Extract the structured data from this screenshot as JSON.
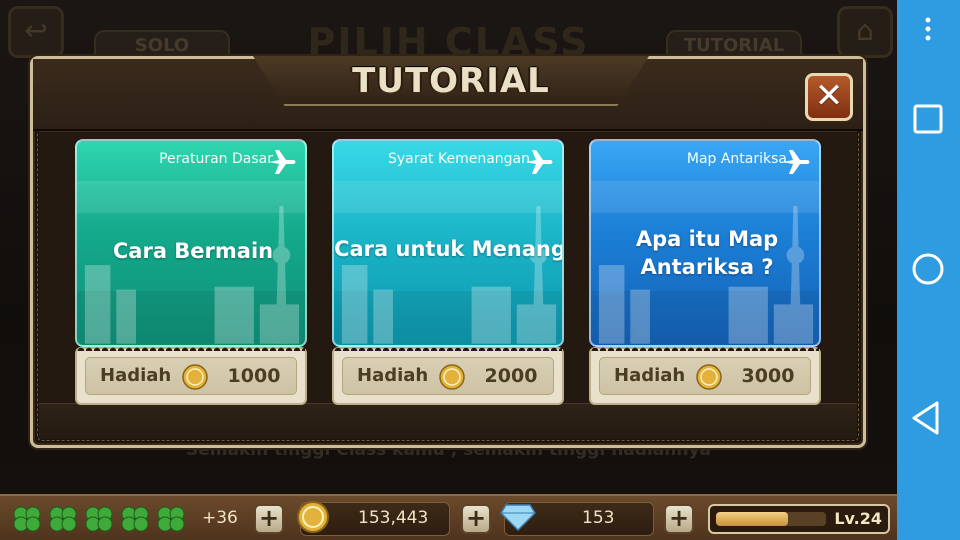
{
  "background": {
    "title": "PILIH CLASS",
    "left_button": "SOLO",
    "right_button": "TUTORIAL",
    "caption": "Semakin tinggi Class kamu , semakin tinggi hadiahnya"
  },
  "dialog": {
    "title": "TUTORIAL",
    "close_label": "✕"
  },
  "cards": [
    {
      "subtitle": "Peraturan Dasar",
      "main_line1": "Cara Bermain",
      "main_line2": "",
      "reward_label": "Hadiah",
      "reward_value": "1000",
      "color": "#1fbf9c"
    },
    {
      "subtitle": "Syarat Kemenangan",
      "main_line1": "Cara untuk Menang",
      "main_line2": "",
      "reward_label": "Hadiah",
      "reward_value": "2000",
      "color": "#22b9cc"
    },
    {
      "subtitle": "Map Antariksa",
      "main_line1": "Apa itu Map",
      "main_line2": "Antariksa ?",
      "reward_label": "Hadiah",
      "reward_value": "3000",
      "color": "#1f7fd8"
    }
  ],
  "status_bar": {
    "clover_count": 5,
    "clover_bonus": "+36",
    "coins": "153,443",
    "gems": "153",
    "level": "Lv.24",
    "xp_fraction": 0.65,
    "plus_label": "+"
  },
  "navbar": {
    "buttons": [
      "menu-dots-icon",
      "recent-apps-icon",
      "home-icon",
      "back-icon"
    ],
    "color": "#2f9be0"
  }
}
